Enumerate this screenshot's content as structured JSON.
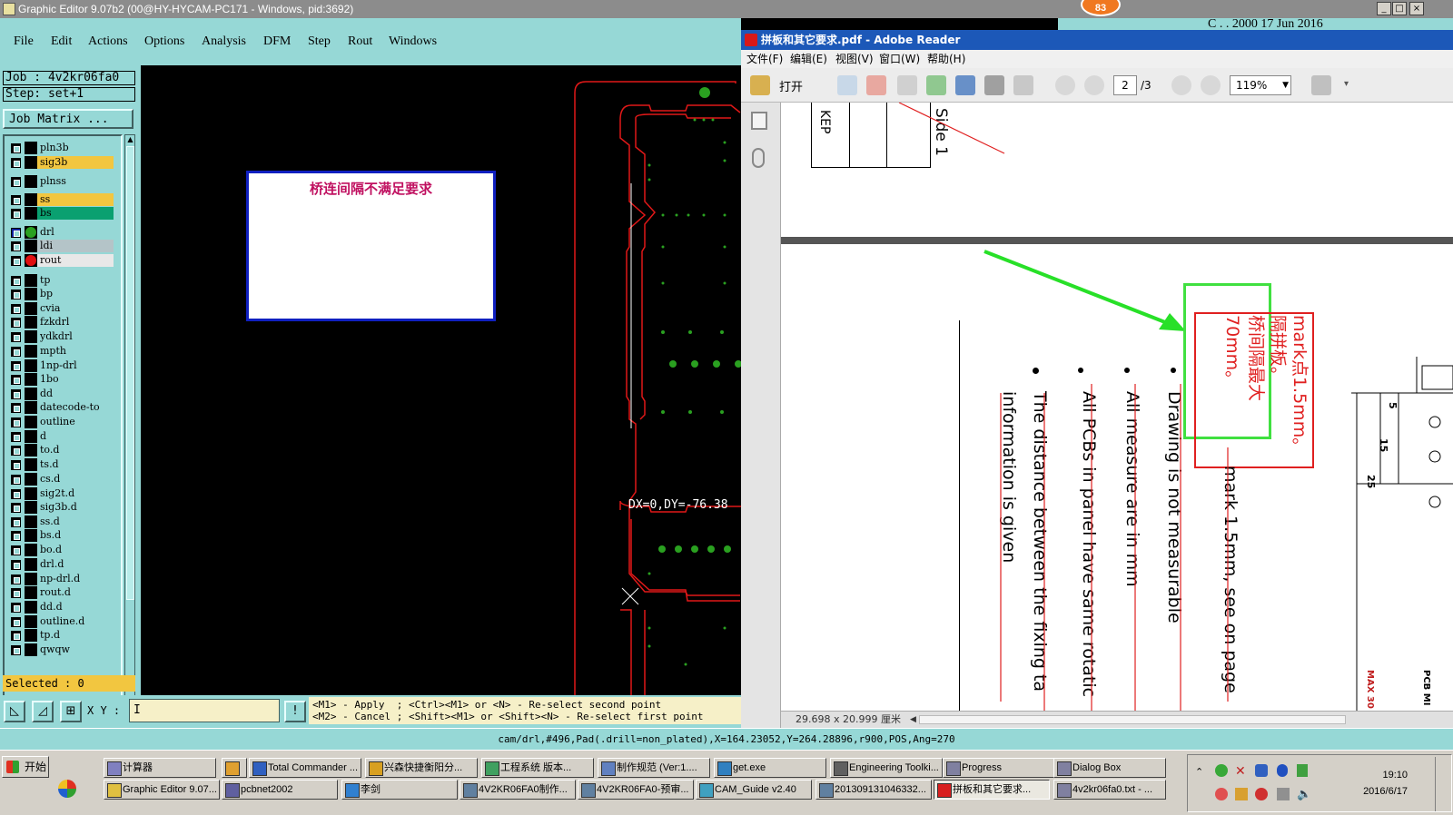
{
  "window": {
    "title": "Graphic Editor 9.07b2 (00@HY-HYCAM-PC171 - Windows, pid:3692)",
    "badge": "83",
    "bg_title_fragment": "C  . . 2000 17  Jun  2016"
  },
  "menu": [
    "File",
    "Edit",
    "Actions",
    "Options",
    "Analysis",
    "DFM",
    "Step",
    "Rout",
    "Windows"
  ],
  "job": {
    "job_label": "Job : 4v2kr06fa0",
    "step_label": "Step:  set+1",
    "matrix_button": "Job Matrix ..."
  },
  "layers": [
    {
      "name": "pln3b",
      "color": "#000000",
      "bg": "#96d8d6"
    },
    {
      "name": "sig3b",
      "color": "#000000",
      "bg": "#f2c640"
    },
    {
      "name": "plnss",
      "color": "#000000",
      "bg": "#96d8d6"
    },
    {
      "name": "ss",
      "color": "#000000",
      "bg": "#f2c640"
    },
    {
      "name": "bs",
      "color": "#000000",
      "bg": "#0aa070"
    },
    {
      "name": "drl",
      "color": "#2aa020",
      "bg": "#96d8d6",
      "active": true
    },
    {
      "name": "ldi",
      "color": "#000000",
      "bg": "#b4c4c8"
    },
    {
      "name": "rout",
      "color": "#e01010",
      "bg": "#e8e8e8"
    },
    {
      "name": "tp",
      "color": "#000000",
      "bg": "#96d8d6"
    },
    {
      "name": "bp",
      "color": "#000000",
      "bg": "#96d8d6"
    },
    {
      "name": "cvia",
      "color": "#000000",
      "bg": "#96d8d6"
    },
    {
      "name": "fzkdrl",
      "color": "#000000",
      "bg": "#96d8d6"
    },
    {
      "name": "ydkdrl",
      "color": "#000000",
      "bg": "#96d8d6"
    },
    {
      "name": "mpth",
      "color": "#000000",
      "bg": "#96d8d6"
    },
    {
      "name": "1np-drl",
      "color": "#000000",
      "bg": "#96d8d6"
    },
    {
      "name": "1bo",
      "color": "#000000",
      "bg": "#96d8d6"
    },
    {
      "name": "dd",
      "color": "#000000",
      "bg": "#96d8d6"
    },
    {
      "name": "datecode-to",
      "color": "#000000",
      "bg": "#96d8d6"
    },
    {
      "name": "outline",
      "color": "#000000",
      "bg": "#96d8d6"
    },
    {
      "name": "d",
      "color": "#000000",
      "bg": "#96d8d6"
    },
    {
      "name": "to.d",
      "color": "#000000",
      "bg": "#96d8d6"
    },
    {
      "name": "ts.d",
      "color": "#000000",
      "bg": "#96d8d6"
    },
    {
      "name": "cs.d",
      "color": "#000000",
      "bg": "#96d8d6"
    },
    {
      "name": "sig2t.d",
      "color": "#000000",
      "bg": "#96d8d6"
    },
    {
      "name": "sig3b.d",
      "color": "#000000",
      "bg": "#96d8d6"
    },
    {
      "name": "ss.d",
      "color": "#000000",
      "bg": "#96d8d6"
    },
    {
      "name": "bs.d",
      "color": "#000000",
      "bg": "#96d8d6"
    },
    {
      "name": "bo.d",
      "color": "#000000",
      "bg": "#96d8d6"
    },
    {
      "name": "drl.d",
      "color": "#000000",
      "bg": "#96d8d6"
    },
    {
      "name": "np-drl.d",
      "color": "#000000",
      "bg": "#96d8d6"
    },
    {
      "name": "rout.d",
      "color": "#000000",
      "bg": "#96d8d6"
    },
    {
      "name": "dd.d",
      "color": "#000000",
      "bg": "#96d8d6"
    },
    {
      "name": "outline.d",
      "color": "#000000",
      "bg": "#96d8d6"
    },
    {
      "name": "tp.d",
      "color": "#000000",
      "bg": "#96d8d6"
    },
    {
      "name": "qwqw",
      "color": "#000000",
      "bg": "#96d8d6"
    }
  ],
  "selected_label": "Selected : 0",
  "canvas": {
    "measure_label": "DX=0,DY=-76.38"
  },
  "popup": {
    "message": "桥连间隔不满足要求"
  },
  "bottom": {
    "xy_label": "X Y :",
    "xy_value": "I",
    "excl_label": "!",
    "hint_line1": "<M1> - Apply  ; <Ctrl><M1> or <N> - Re-select second point",
    "hint_line2": "<M2> - Cancel ; <Shift><M1> or <Shift><N> - Re-select first point"
  },
  "status": "cam/drl,#496,Pad(.drill=non_plated),X=164.23052,Y=264.28896,r900,POS,Ang=270",
  "adobe": {
    "title": "拼板和其它要求.pdf - Adobe Reader",
    "menu": [
      "文件(F)",
      "编辑(E)",
      "视图(V)",
      "窗口(W)",
      "帮助(H)"
    ],
    "open_label": "打开",
    "page_current": "2",
    "page_total": "/3",
    "zoom": "119%",
    "page_size": "29.698 x 20.999 厘米",
    "top_text_1": "KEP",
    "top_text_2": "Side 1",
    "anno_1": "mark点1.5mm。",
    "anno_2": "隔拼板。",
    "anno_3": "桥间隔最大",
    "anno_4": "70mm。",
    "line_mark": "mark 1.5mm, see on page",
    "line_drawing": "Drawing is not measurable",
    "line_measure": "All measure are in mm",
    "line_pcbs": "All PCBs in panel have same rotatic",
    "line_distance": "The distance between the fixing ta",
    "line_info": "information is given",
    "side_15": "15",
    "side_25": "25",
    "side_5": "5",
    "side_max": "MAX 30",
    "side_pcb": "PCB MI"
  },
  "taskbar": {
    "start": "开始",
    "row1": [
      "计算器",
      "",
      "Total Commander ...",
      "兴森快捷衡阳分...",
      "工程系统  版本...",
      "制作规范 (Ver:1....",
      "get.exe",
      "Engineering Toolki...",
      "Progress",
      "Dialog Box"
    ],
    "row2": [
      "Graphic Editor 9.07...",
      "pcbnet2002",
      "李剑",
      "4V2KR06FA0制作...",
      "4V2KR06FA0-预审...",
      "CAM_Guide v2.40",
      "201309131046332...",
      "拼板和其它要求...",
      "4v2kr06fa0.txt - ..."
    ],
    "time": "19:10",
    "date": "2016/6/17"
  }
}
